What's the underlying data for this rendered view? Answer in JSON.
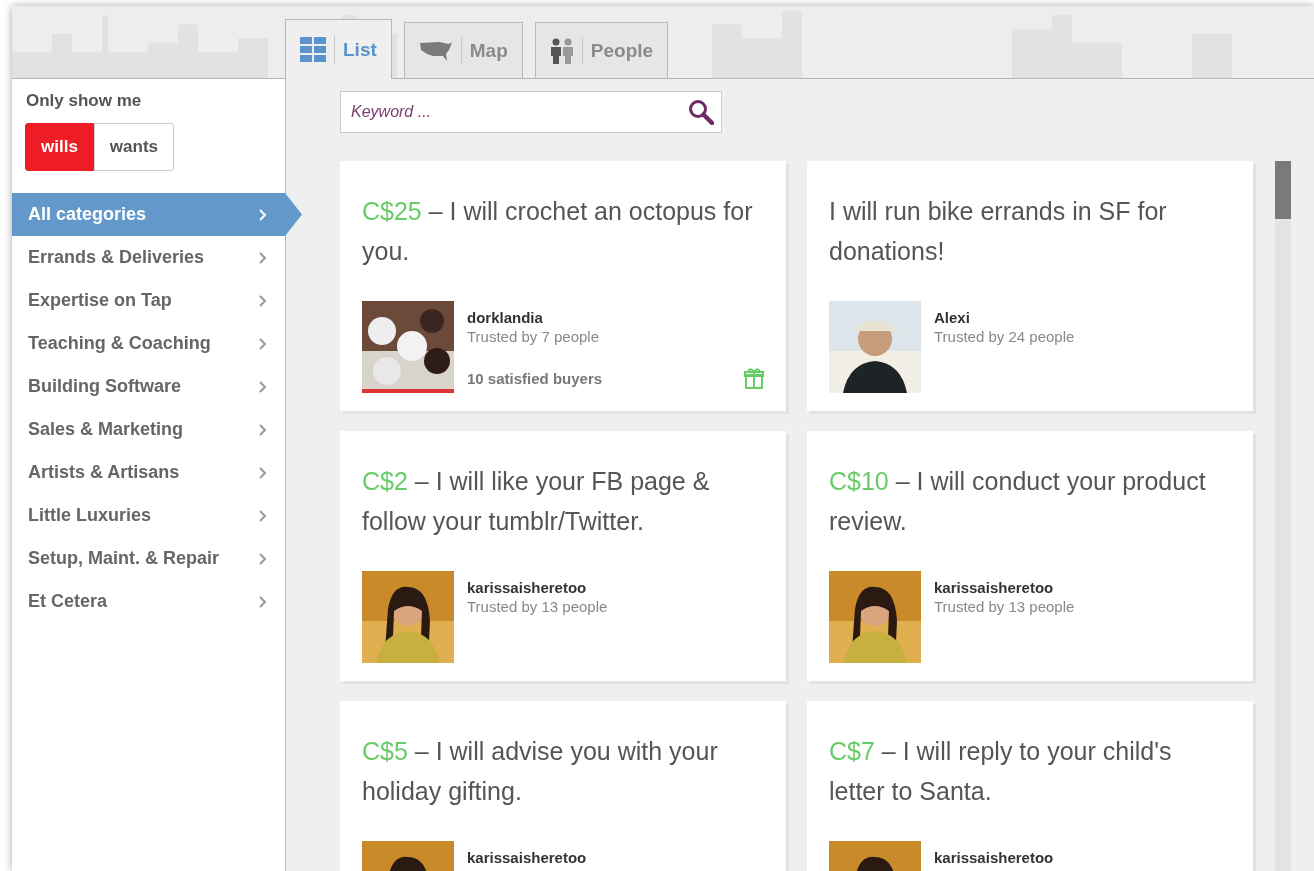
{
  "tabs": [
    {
      "label": "List",
      "selected": true
    },
    {
      "label": "Map",
      "selected": false
    },
    {
      "label": "People",
      "selected": false
    }
  ],
  "sidebar": {
    "heading": "Only show me",
    "toggle": [
      {
        "label": "wills",
        "selected": true
      },
      {
        "label": "wants",
        "selected": false
      }
    ],
    "categories": [
      {
        "label": "All categories",
        "selected": true
      },
      {
        "label": "Errands & Deliveries",
        "selected": false
      },
      {
        "label": "Expertise on Tap",
        "selected": false
      },
      {
        "label": "Teaching & Coaching",
        "selected": false
      },
      {
        "label": "Building Software",
        "selected": false
      },
      {
        "label": "Sales & Marketing",
        "selected": false
      },
      {
        "label": "Artists & Artisans",
        "selected": false
      },
      {
        "label": "Little Luxuries",
        "selected": false
      },
      {
        "label": "Setup, Maint. & Repair",
        "selected": false
      },
      {
        "label": "Et Cetera",
        "selected": false
      }
    ]
  },
  "search": {
    "placeholder": "Keyword ..."
  },
  "cards": [
    {
      "price": "C$25",
      "title": "– I will crochet an octopus for you.",
      "user": "dorklandia",
      "trusted": "Trusted by 7 people",
      "buyers": "10 satisfied buyers",
      "gift": true
    },
    {
      "title": "I will run bike errands in SF for donations!",
      "user": "Alexi",
      "trusted": "Trusted by 24 people",
      "gift": false
    },
    {
      "price": "C$2",
      "title": "– I will like your FB page & follow your tumblr/Twitter.",
      "user": "karissaisheretoo",
      "trusted": "Trusted by 13 people",
      "gift": false
    },
    {
      "price": "C$10",
      "title": "– I will conduct your product review.",
      "user": "karissaisheretoo",
      "trusted": "Trusted by 13 people",
      "gift": false
    },
    {
      "price": "C$5",
      "title": "– I will advise you with your holiday gifting.",
      "user": "karissaisheretoo",
      "gift": false
    },
    {
      "price": "C$7",
      "title": "– I will reply to your child's letter to Santa.",
      "user": "karissaisheretoo",
      "gift": false
    }
  ]
}
